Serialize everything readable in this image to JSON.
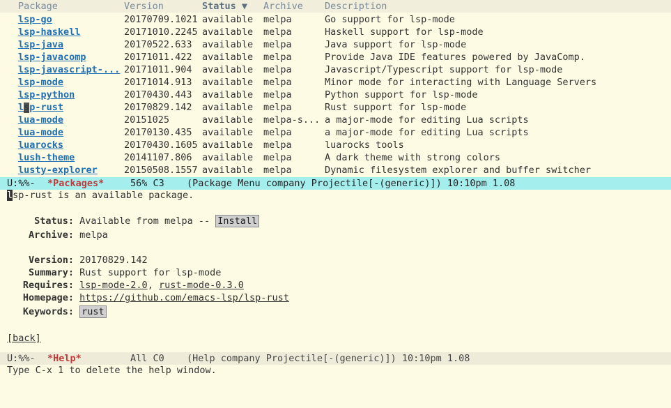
{
  "package_list": {
    "columns": {
      "package": "Package",
      "version": "Version",
      "status": "Status ▼",
      "archive": "Archive",
      "description": "Description"
    },
    "rows": [
      {
        "name": "lsp-go",
        "version": "20170709.1021",
        "status": "available",
        "archive": "melpa",
        "description": "Go support for lsp-mode"
      },
      {
        "name": "lsp-haskell",
        "version": "20171010.2245",
        "status": "available",
        "archive": "melpa",
        "description": "Haskell support for lsp-mode"
      },
      {
        "name": "lsp-java",
        "version": "20170522.633",
        "status": "available",
        "archive": "melpa",
        "description": "Java support for lsp-mode"
      },
      {
        "name": "lsp-javacomp",
        "version": "20171011.422",
        "status": "available",
        "archive": "melpa",
        "description": "Provide Java IDE features powered by JavaComp."
      },
      {
        "name": "lsp-javascript-...",
        "version": "20171011.904",
        "status": "available",
        "archive": "melpa",
        "description": "Javascript/Typescript support for lsp-mode"
      },
      {
        "name": "lsp-mode",
        "version": "20171014.913",
        "status": "available",
        "archive": "melpa",
        "description": "Minor mode for interacting with Language Servers"
      },
      {
        "name": "lsp-python",
        "version": "20170430.443",
        "status": "available",
        "archive": "melpa",
        "description": "Python support for lsp-mode"
      },
      {
        "name": "lsp-rust",
        "version": "20170829.142",
        "status": "available",
        "archive": "melpa",
        "description": "Rust support for lsp-mode"
      },
      {
        "name": "lua-mode",
        "version": "20151025",
        "status": "available",
        "archive": "melpa-s...",
        "description": "a major-mode for editing Lua scripts"
      },
      {
        "name": "lua-mode",
        "version": "20170130.435",
        "status": "available",
        "archive": "melpa",
        "description": "a major-mode for editing Lua scripts"
      },
      {
        "name": "luarocks",
        "version": "20170430.1605",
        "status": "available",
        "archive": "melpa",
        "description": "luarocks tools"
      },
      {
        "name": "lush-theme",
        "version": "20141107.806",
        "status": "available",
        "archive": "melpa",
        "description": "A dark theme with strong colors"
      },
      {
        "name": "lusty-explorer",
        "version": "20150508.1557",
        "status": "available",
        "archive": "melpa",
        "description": "Dynamic filesystem explorer and buffer switcher"
      }
    ]
  },
  "mode_line_top": {
    "prefix": "U:%%-",
    "buffer": "*Packages*",
    "position": "56% C3",
    "modes": "(Package Menu company Projectile[-(generic)]) 10:10pm 1.08"
  },
  "help": {
    "intro_first": "l",
    "intro_rest": "sp-rust is an available package.",
    "status_label": "Status:",
    "status_value": "Available from melpa -- ",
    "install_button": "Install",
    "archive_label": "Archive:",
    "archive_value": "melpa",
    "version_label": "Version:",
    "version_value": "20170829.142",
    "summary_label": "Summary:",
    "summary_value": "Rust support for lsp-mode",
    "requires_label": "Requires:",
    "requires_1": "lsp-mode-2.0",
    "requires_sep": ", ",
    "requires_2": "rust-mode-0.3.0",
    "homepage_label": "Homepage:",
    "homepage_value": "https://github.com/emacs-lsp/lsp-rust",
    "keywords_label": "Keywords:",
    "keyword_1": "rust",
    "back_link": "[back]"
  },
  "mode_line_bottom": {
    "prefix": "U:%%-",
    "buffer": "*Help*",
    "position": "All C0",
    "modes": "(Help company Projectile[-(generic)]) 10:10pm 1.08"
  },
  "echo_area": "Type C-x 1 to delete the help window."
}
